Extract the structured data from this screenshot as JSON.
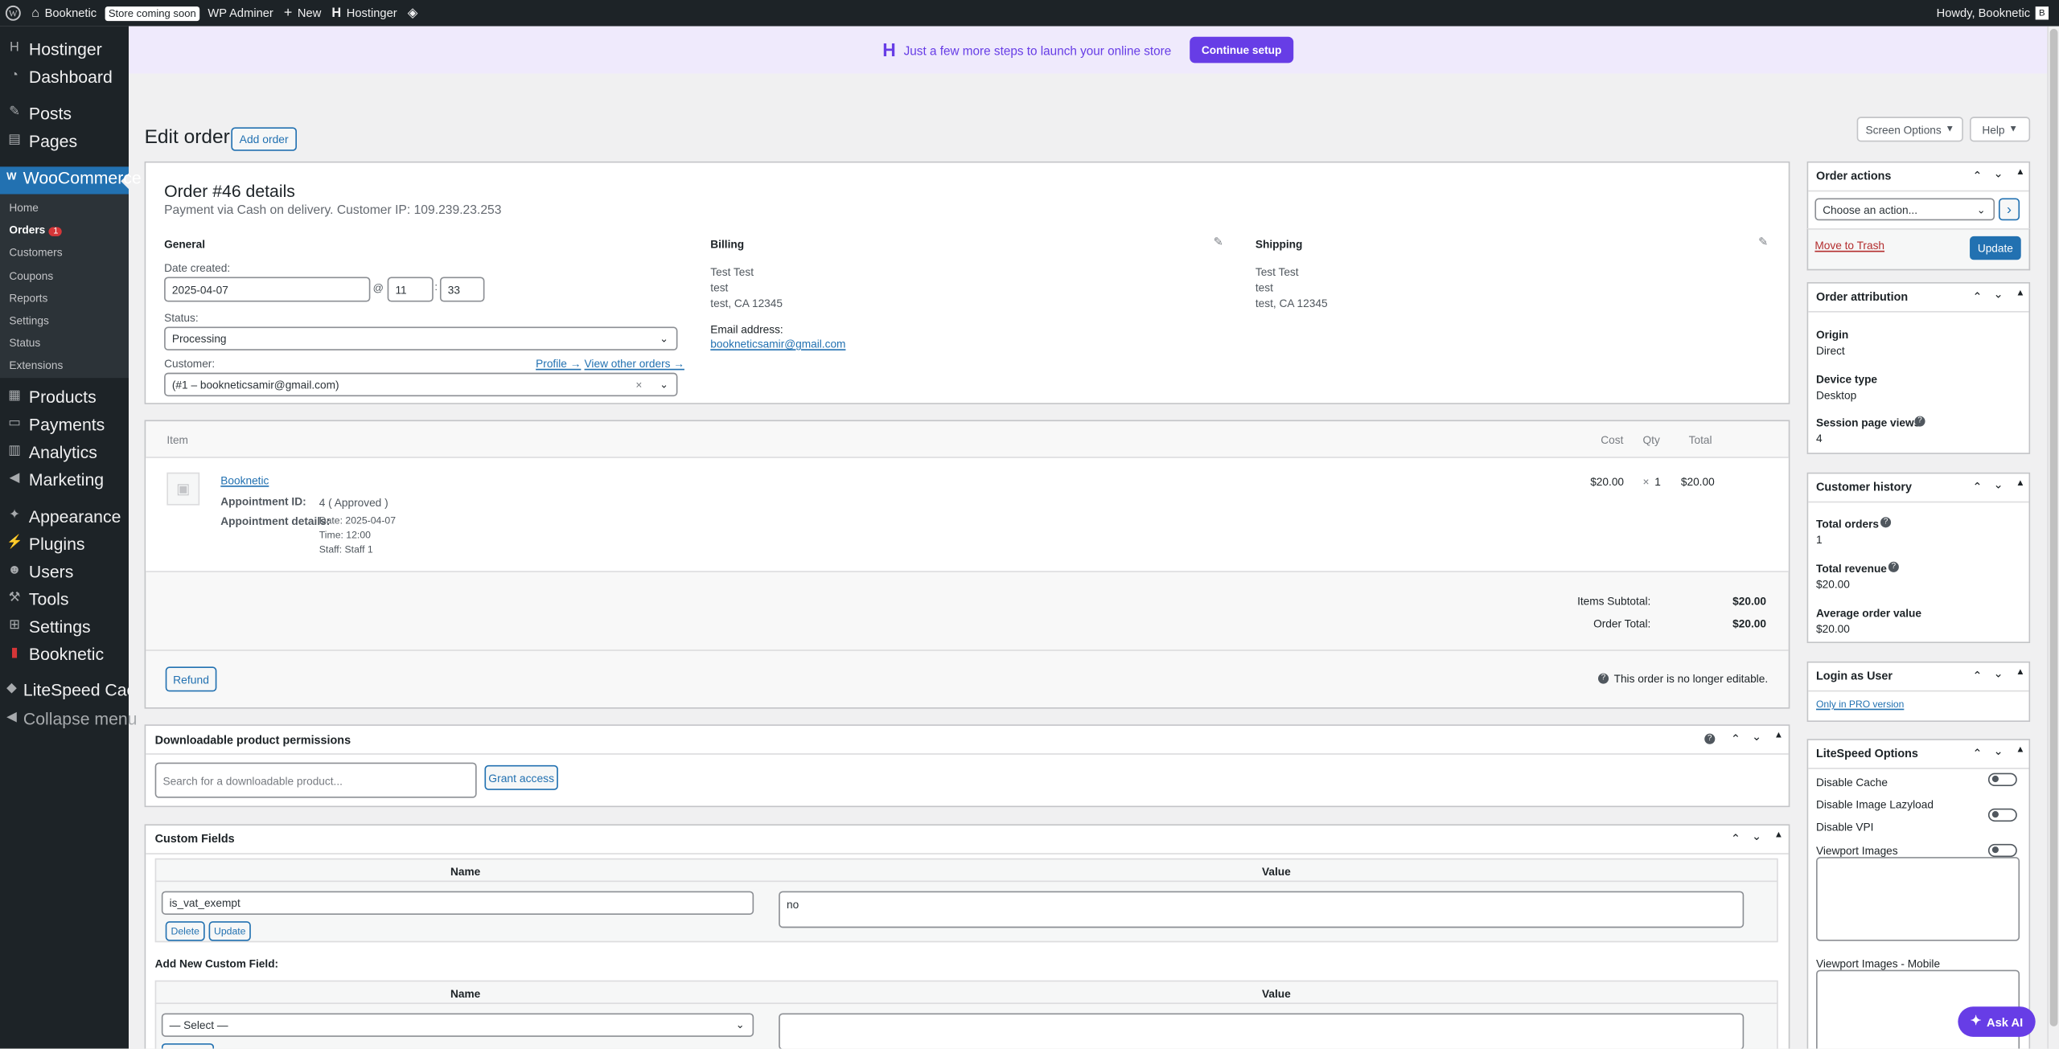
{
  "adminbar": {
    "site_name": "Booknetic",
    "store_status": "Store coming soon",
    "wp_adminer": "WP Adminer",
    "new": "New",
    "hostinger": "Hostinger",
    "howdy": "Howdy, Booknetic"
  },
  "sidebar": {
    "items": [
      {
        "label": "Hostinger",
        "icon": "hostinger-icon"
      },
      {
        "label": "Dashboard",
        "icon": "dashboard-icon"
      },
      {
        "label": "Posts",
        "icon": "pin-icon"
      },
      {
        "label": "Pages",
        "icon": "pages-icon"
      },
      {
        "label": "WooCommerce",
        "icon": "woo-icon"
      },
      {
        "label": "Products",
        "icon": "products-icon"
      },
      {
        "label": "Payments",
        "icon": "payments-icon"
      },
      {
        "label": "Analytics",
        "icon": "analytics-icon"
      },
      {
        "label": "Marketing",
        "icon": "marketing-icon"
      },
      {
        "label": "Appearance",
        "icon": "appearance-icon"
      },
      {
        "label": "Plugins",
        "icon": "plugins-icon"
      },
      {
        "label": "Users",
        "icon": "users-icon"
      },
      {
        "label": "Tools",
        "icon": "tools-icon"
      },
      {
        "label": "Settings",
        "icon": "settings-icon"
      },
      {
        "label": "Booknetic",
        "icon": "booknetic-icon"
      },
      {
        "label": "LiteSpeed Cache",
        "icon": "litespeed-icon"
      },
      {
        "label": "Collapse menu",
        "icon": "collapse-icon"
      }
    ],
    "woo_sub": [
      "Home",
      "Orders",
      "Customers",
      "Coupons",
      "Reports",
      "Settings",
      "Status",
      "Extensions"
    ],
    "orders_badge": "1"
  },
  "banner": {
    "text": "Just a few more steps to launch your online store",
    "button": "Continue setup"
  },
  "header": {
    "title": "Edit order",
    "add_order": "Add order",
    "screen_options": "Screen Options",
    "help": "Help"
  },
  "order": {
    "title": "Order #46 details",
    "subtitle": "Payment via Cash on delivery. Customer IP: 109.239.23.253",
    "general_heading": "General",
    "date_label": "Date created:",
    "date_value": "2025-04-07",
    "at": "@",
    "hour": "11",
    "colon": ":",
    "minute": "33",
    "status_label": "Status:",
    "status_value": "Processing",
    "customer_label": "Customer:",
    "profile_link": "Profile →",
    "view_orders_link": "View other orders →",
    "customer_value": "(#1 – bookneticsamir@gmail.com)",
    "clear": "×",
    "billing_heading": "Billing",
    "billing_lines": [
      "Test Test",
      "test",
      "test, CA 12345"
    ],
    "email_label": "Email address:",
    "email_value": "bookneticsamir@gmail.com",
    "shipping_heading": "Shipping",
    "shipping_lines": [
      "Test Test",
      "test",
      "test, CA 12345"
    ]
  },
  "items": {
    "col_item": "Item",
    "col_cost": "Cost",
    "col_qty": "Qty",
    "col_total": "Total",
    "product_name": "Booknetic",
    "appt_id_label": "Appointment ID:",
    "appt_id_value": "4 ( Approved )",
    "appt_details_label": "Appointment details:",
    "appt_details": [
      "Date: 2025-04-07",
      "Time: 12:00",
      "Staff: Staff 1"
    ],
    "cost": "$20.00",
    "qty_x": "×",
    "qty": "1",
    "total": "$20.00",
    "subtotal_label": "Items Subtotal:",
    "subtotal_value": "$20.00",
    "order_total_label": "Order Total:",
    "order_total_value": "$20.00",
    "refund": "Refund",
    "not_editable": "This order is no longer editable."
  },
  "downloads": {
    "title": "Downloadable product permissions",
    "search_placeholder": "Search for a downloadable product...",
    "grant": "Grant access"
  },
  "custom_fields": {
    "title": "Custom Fields",
    "col_name": "Name",
    "col_value": "Value",
    "row_name": "is_vat_exempt",
    "row_value": "no",
    "delete": "Delete",
    "update": "Update",
    "add_new": "Add New Custom Field:",
    "select": "— Select —"
  },
  "order_actions": {
    "title": "Order actions",
    "select": "Choose an action...",
    "go": "›",
    "trash": "Move to Trash",
    "update": "Update"
  },
  "attribution": {
    "title": "Order attribution",
    "origin_label": "Origin",
    "origin_value": "Direct",
    "device_label": "Device type",
    "device_value": "Desktop",
    "views_label": "Session page views",
    "views_value": "4"
  },
  "history": {
    "title": "Customer history",
    "total_orders_label": "Total orders",
    "total_orders_value": "1",
    "revenue_label": "Total revenue",
    "revenue_value": "$20.00",
    "aov_label": "Average order value",
    "aov_value": "$20.00"
  },
  "login_as": {
    "title": "Login as User",
    "pro": "Only in PRO version"
  },
  "litespeed": {
    "title": "LiteSpeed Options",
    "disable_cache": "Disable Cache",
    "disable_lazy": "Disable Image Lazyload",
    "disable_vpi": "Disable VPI",
    "viewport": "Viewport Images",
    "viewport_mobile": "Viewport Images - Mobile"
  },
  "ask_ai": "Ask AI",
  "colors": {
    "accent": "#2271b1",
    "admin_bar": "#1d2327",
    "hostinger": "#673de6",
    "badge": "#d63638"
  }
}
